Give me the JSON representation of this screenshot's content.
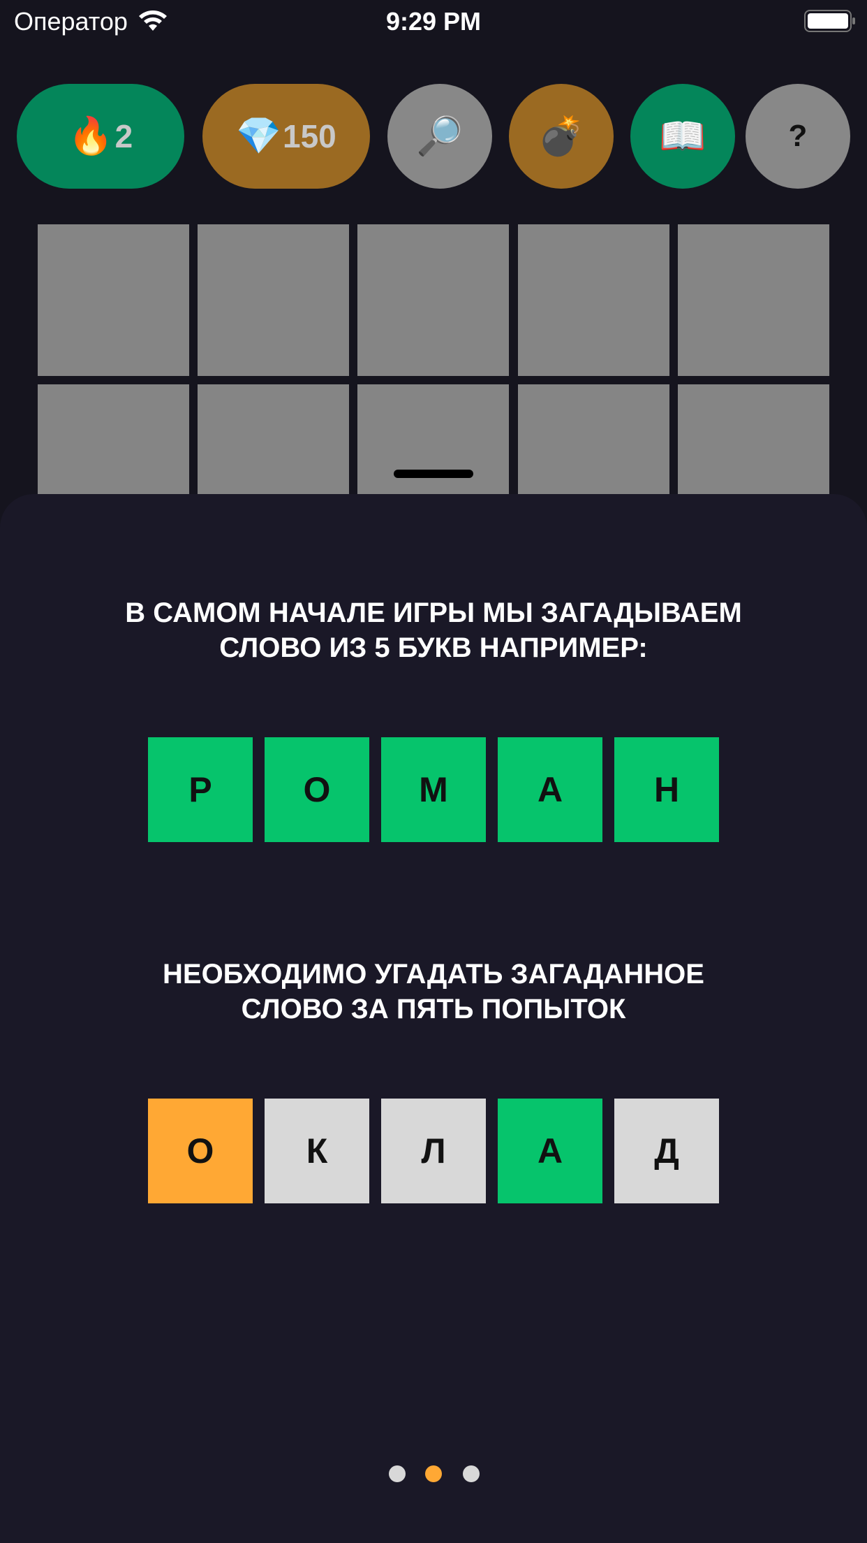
{
  "status_bar": {
    "carrier": "Оператор",
    "time": "9:29 PM",
    "wifi_icon": "wifi-icon",
    "battery_icon": "battery-icon"
  },
  "toolbar": {
    "streak": {
      "icon": "🔥",
      "value": "2",
      "color": "#04865a"
    },
    "gems": {
      "icon": "💎",
      "value": "150",
      "color": "#9b6a22"
    },
    "search": {
      "icon": "🔎",
      "color": "#888888"
    },
    "bomb": {
      "icon": "💣",
      "color": "#9b6a22"
    },
    "book": {
      "icon": "📖",
      "color": "#04865a"
    },
    "help": {
      "label": "?",
      "color": "#888888"
    }
  },
  "background_grid": {
    "cell_color": "#858585"
  },
  "tutorial": {
    "step_1": {
      "text": "В САМОМ НАЧАЛЕ ИГРЫ МЫ ЗАГАДЫВАЕМ СЛОВО ИЗ 5 БУКВ НАПРИМЕР:",
      "tiles": [
        {
          "letter": "Р",
          "state": "correct"
        },
        {
          "letter": "О",
          "state": "correct"
        },
        {
          "letter": "М",
          "state": "correct"
        },
        {
          "letter": "А",
          "state": "correct"
        },
        {
          "letter": "Н",
          "state": "correct"
        }
      ]
    },
    "step_2": {
      "text": "НЕОБХОДИМО УГАДАТЬ ЗАГАДАННОЕ СЛОВО ЗА ПЯТЬ ПОПЫТОК",
      "tiles": [
        {
          "letter": "О",
          "state": "present"
        },
        {
          "letter": "К",
          "state": "absent"
        },
        {
          "letter": "Л",
          "state": "absent"
        },
        {
          "letter": "А",
          "state": "correct"
        },
        {
          "letter": "Д",
          "state": "absent"
        }
      ]
    }
  },
  "tile_colors": {
    "correct": "#06c46c",
    "present": "#ffa834",
    "absent": "#d8d8d8"
  },
  "pager": {
    "count": 3,
    "active_index": 1,
    "active_color": "#ffa834",
    "inactive_color": "#d8d8d8"
  }
}
